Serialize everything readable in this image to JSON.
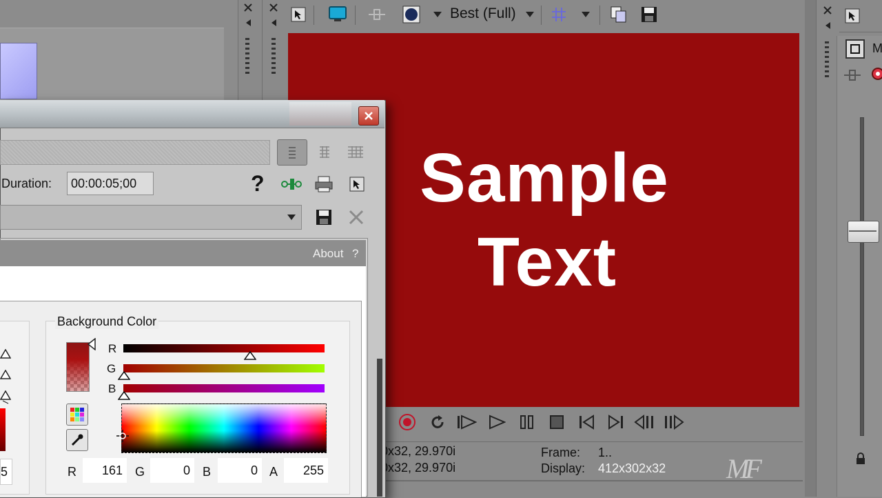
{
  "preview": {
    "quality_label": "Best (Full)",
    "text_line1": "Sample",
    "text_line2": "Text",
    "bg_color": "#960b0c"
  },
  "status": {
    "project_line1": "0x32, 29.970i",
    "project_line2": "0x32, 29.970i",
    "frame_label": "Frame:",
    "frame_value": "1..",
    "display_label": "Display:",
    "display_value": "412x302x32",
    "watermark": "MF"
  },
  "dialog": {
    "duration_label": "Duration:",
    "duration_value": "00:00:05;00",
    "help_glyph": "?",
    "about_label": "About",
    "about_help": "?",
    "bg_color_title": "Background Color",
    "channels": {
      "r_label": "R",
      "g_label": "G",
      "b_label": "B",
      "a_label": "A",
      "r_value": "161",
      "g_value": "0",
      "b_value": "0",
      "a_value": "255"
    },
    "slider_labels": {
      "r": "R",
      "g": "G",
      "b": "B"
    },
    "left_value_fragment": "5"
  },
  "right_panel": {
    "m_label": "M"
  },
  "icons": [
    "close-icon",
    "pin-icon",
    "select-arrow-icon",
    "monitor-icon",
    "split-icon",
    "overlay-icon",
    "dropdown-arrow-icon",
    "grid-icon",
    "copy-icon",
    "save-icon",
    "help-icon",
    "keyframe-icon",
    "print-icon",
    "delete-icon",
    "record-icon",
    "loop-icon",
    "play-from-start-icon",
    "play-icon",
    "pause-icon",
    "stop-icon",
    "prev-frame-icon",
    "next-frame-icon",
    "prev-marker-icon",
    "next-marker-icon",
    "lock-icon"
  ],
  "colors": {
    "chrome": "#8a8a8a",
    "dialog_bg": "#c8c8c8",
    "accent_red": "#960b0c",
    "close_button": "#cc4a3c"
  }
}
